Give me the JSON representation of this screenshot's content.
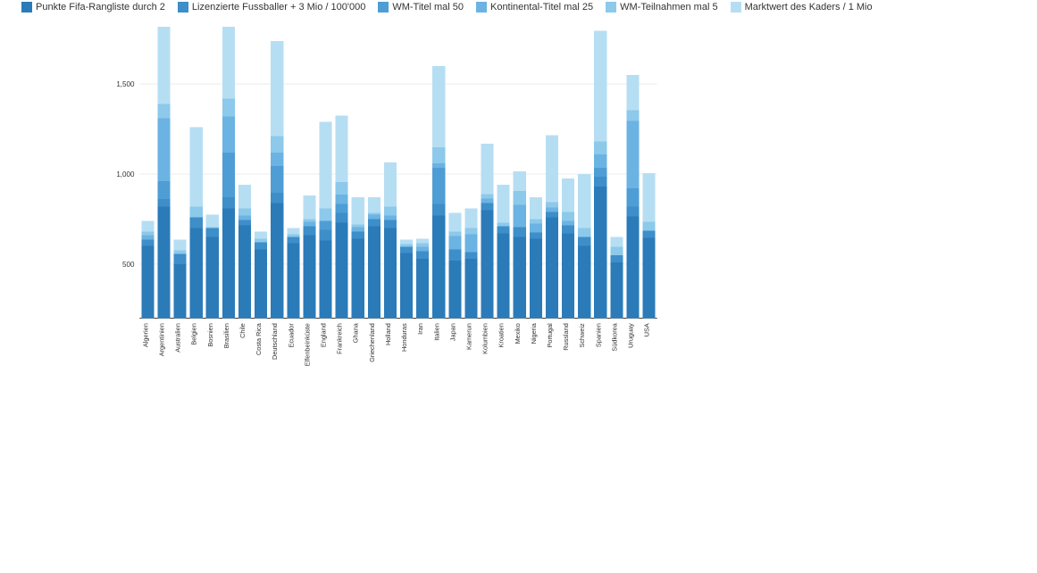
{
  "chart_data": {
    "type": "bar",
    "title": "",
    "xlabel": "",
    "ylabel": "",
    "ylim": [
      200,
      1800
    ],
    "yticks": [
      500,
      1000,
      1500
    ],
    "categories": [
      "Algerien",
      "Argentinien",
      "Australien",
      "Belgien",
      "Bosnien",
      "Brasilien",
      "Chile",
      "Costa Rica",
      "Deutschland",
      "Ecuador",
      "Elfenbeinküste",
      "England",
      "Frankreich",
      "Ghana",
      "Griechenland",
      "Holland",
      "Honduras",
      "Iran",
      "Italien",
      "Japan",
      "Kamerun",
      "Kolumbien",
      "Kroatien",
      "Mexiko",
      "Nigeria",
      "Portugal",
      "Russland",
      "Schweiz",
      "Spanien",
      "Südkorea",
      "Uruguay",
      "USA"
    ],
    "series": [
      {
        "name": "Punkte Fifa-Rangliste durch 2",
        "color": "#2B7BB9",
        "values": [
          400,
          620,
          300,
          500,
          450,
          610,
          515,
          380,
          640,
          415,
          460,
          430,
          530,
          440,
          510,
          500,
          360,
          330,
          570,
          320,
          330,
          600,
          470,
          450,
          440,
          560,
          470,
          400,
          730,
          310,
          565,
          445
        ]
      },
      {
        "name": "Lizenzierte Fussballer + 3 Mio / 100'000",
        "color": "#3D8EC9",
        "values": [
          35,
          40,
          55,
          60,
          50,
          60,
          30,
          40,
          55,
          35,
          50,
          60,
          55,
          40,
          40,
          45,
          35,
          40,
          65,
          60,
          35,
          38,
          40,
          55,
          35,
          30,
          45,
          50,
          55,
          40,
          55,
          40
        ]
      },
      {
        "name": "WM-Titel mal 50",
        "color": "#4F9DD5",
        "values": [
          0,
          100,
          0,
          0,
          0,
          250,
          0,
          0,
          150,
          0,
          0,
          50,
          50,
          0,
          0,
          0,
          0,
          0,
          200,
          0,
          0,
          0,
          0,
          0,
          0,
          0,
          0,
          0,
          50,
          0,
          100,
          0
        ]
      },
      {
        "name": "Kontinental-Titel mal 25",
        "color": "#6BB3E2",
        "values": [
          25,
          350,
          0,
          0,
          0,
          200,
          25,
          0,
          75,
          0,
          25,
          0,
          50,
          25,
          25,
          25,
          0,
          25,
          25,
          75,
          100,
          25,
          0,
          125,
          50,
          25,
          25,
          0,
          75,
          0,
          375,
          0
        ]
      },
      {
        "name": "WM-Teilnahmen mal 5",
        "color": "#8CC9EB",
        "values": [
          20,
          80,
          20,
          60,
          5,
          100,
          40,
          20,
          90,
          15,
          15,
          70,
          70,
          15,
          10,
          50,
          15,
          20,
          90,
          25,
          35,
          25,
          20,
          75,
          25,
          30,
          50,
          50,
          70,
          45,
          60,
          50
        ]
      },
      {
        "name": "Marktwert des Kaders / 1 Mio",
        "color": "#B6DEF3",
        "values": [
          60,
          565,
          60,
          440,
          70,
          500,
          130,
          40,
          530,
          35,
          130,
          480,
          370,
          150,
          85,
          245,
          25,
          25,
          450,
          105,
          110,
          280,
          210,
          110,
          120,
          370,
          185,
          300,
          615,
          55,
          195,
          270
        ]
      }
    ],
    "legend_position": "top"
  }
}
